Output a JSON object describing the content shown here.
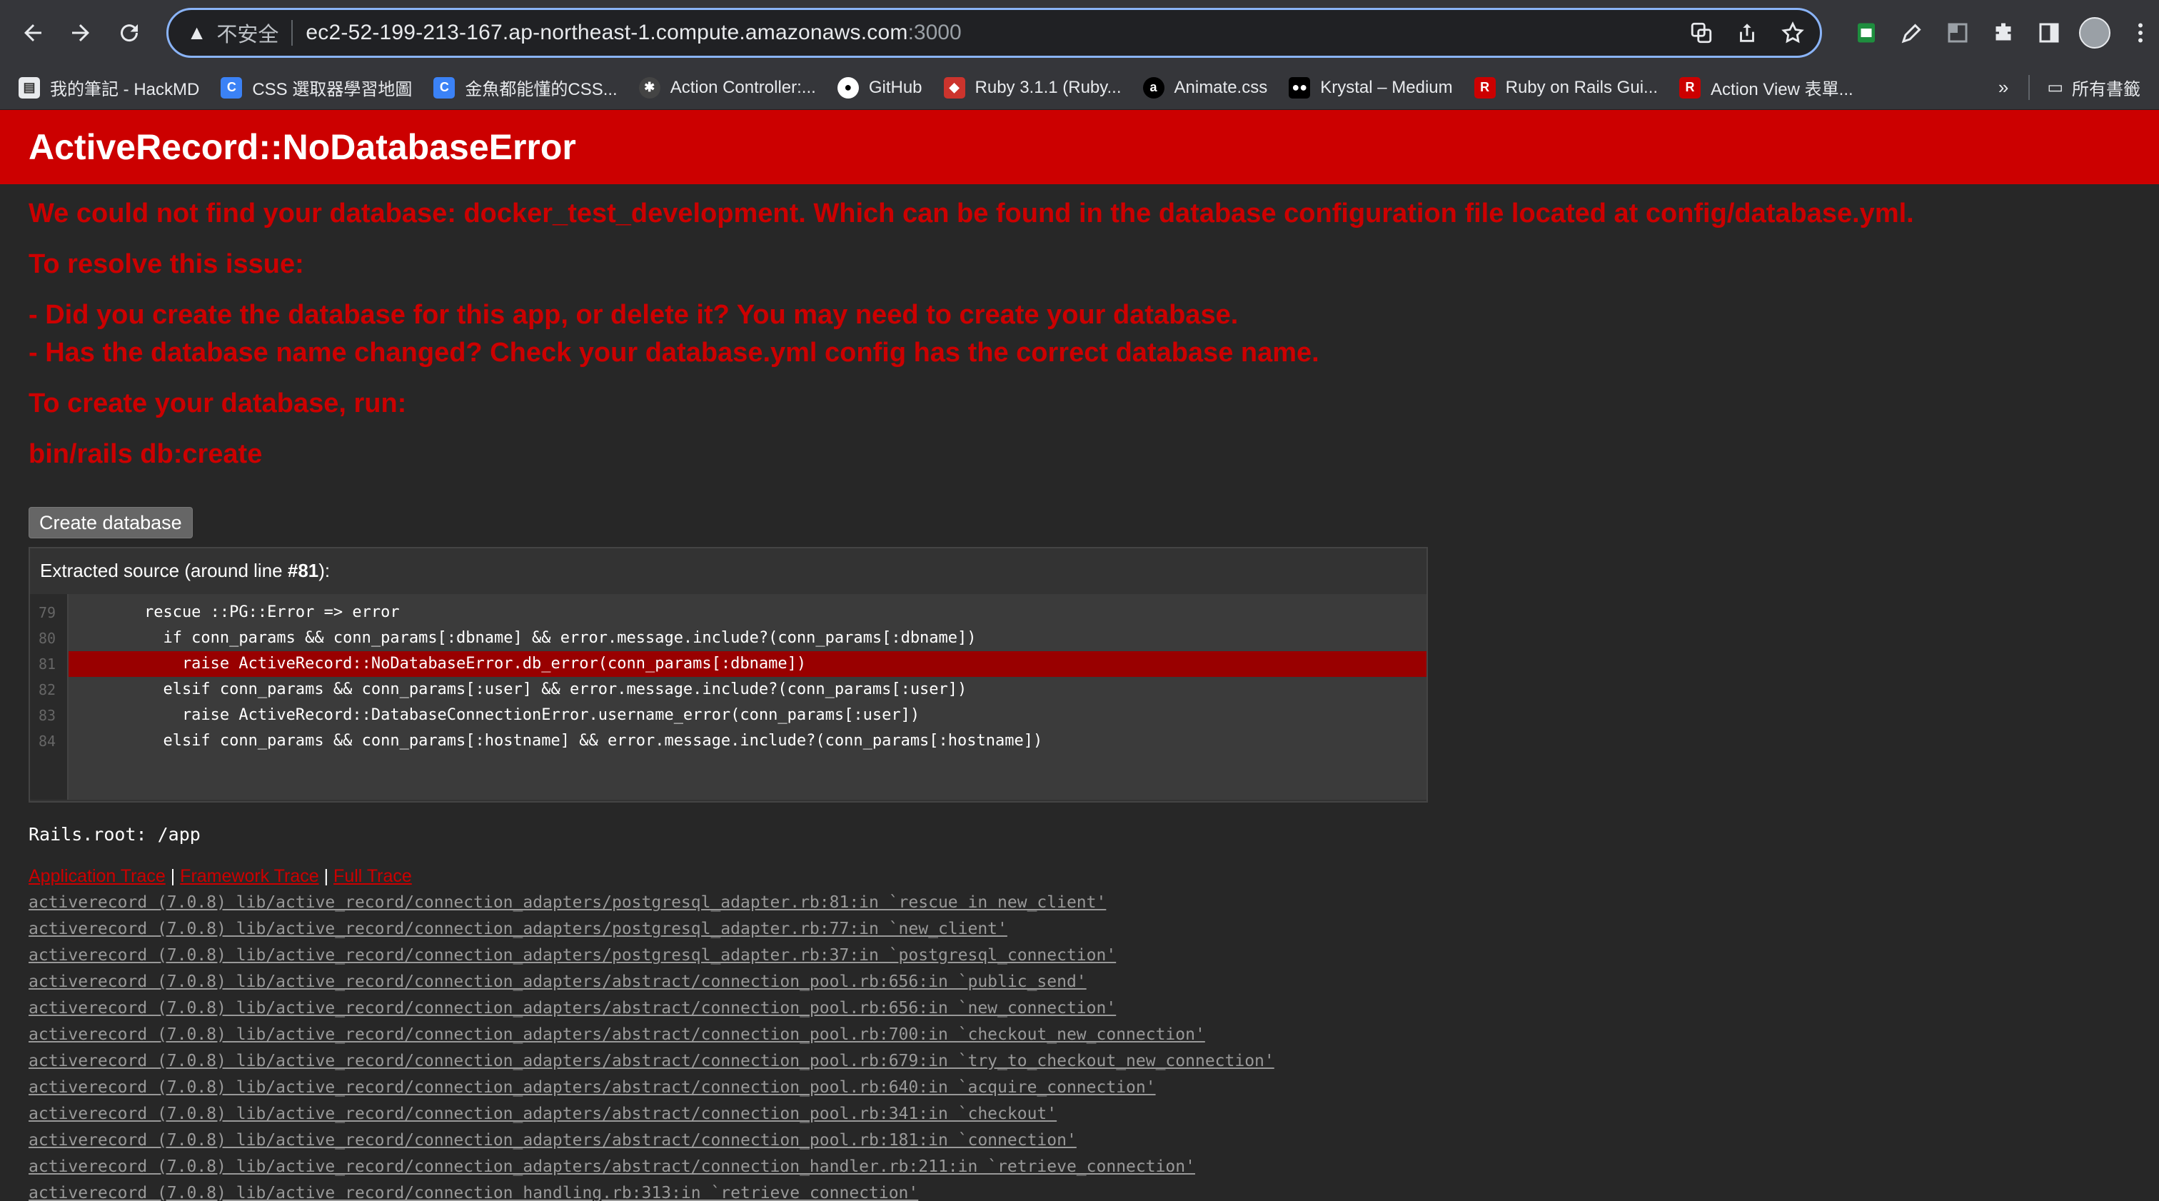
{
  "browser": {
    "security_label": "不安全",
    "url_host": "ec2-52-199-213-167.ap-northeast-1.compute.amazonaws.com",
    "url_port": ":3000",
    "bookmarks": [
      {
        "label": "我的筆記 - HackMD",
        "icon": "document-icon",
        "color": "#e8eaed"
      },
      {
        "label": "CSS 選取器學習地圖",
        "icon": "site-icon",
        "color": "#3b82f6"
      },
      {
        "label": "金魚都能懂的CSS...",
        "icon": "site-icon",
        "color": "#3b82f6"
      },
      {
        "label": "Action Controller:...",
        "icon": "site-icon",
        "color": "#444444"
      },
      {
        "label": "GitHub",
        "icon": "github-icon",
        "color": "#ffffff"
      },
      {
        "label": "Ruby 3.1.1 (Ruby...",
        "icon": "ruby-icon",
        "color": "#cc342d"
      },
      {
        "label": "Animate.css",
        "icon": "animate-icon",
        "color": "#000000"
      },
      {
        "label": "Krystal – Medium",
        "icon": "medium-icon",
        "color": "#000000"
      },
      {
        "label": "Ruby on Rails Gui...",
        "icon": "rails-icon",
        "color": "#cc0000"
      },
      {
        "label": "Action View 表單...",
        "icon": "rails-icon",
        "color": "#cc0000"
      }
    ],
    "bookmarks_more": "»",
    "all_bookmarks": "所有書籤"
  },
  "page": {
    "title": "ActiveRecord::NoDatabaseError",
    "message": "We could not find your database: docker_test_development. Which can be found in the database configuration file located at config/database.yml.",
    "resolve": "To resolve this issue:",
    "suggestions": [
      "- Did you create the database for this app, or delete it? You may need to create your database.",
      "- Has the database name changed? Check your database.yml config has the correct database name."
    ],
    "create_prompt": "To create your database, run:",
    "command": "bin/rails db:create",
    "create_button": "Create database",
    "source_label": "Extracted source (around line ",
    "source_line": "#81",
    "source_suffix": "):",
    "code": [
      {
        "num": "79",
        "text": "        rescue ::PG::Error => error"
      },
      {
        "num": "80",
        "text": "          if conn_params && conn_params[:dbname] && error.message.include?(conn_params[:dbname])"
      },
      {
        "num": "81",
        "text": "            raise ActiveRecord::NoDatabaseError.db_error(conn_params[:dbname])"
      },
      {
        "num": "82",
        "text": "          elsif conn_params && conn_params[:user] && error.message.include?(conn_params[:user])"
      },
      {
        "num": "83",
        "text": "            raise ActiveRecord::DatabaseConnectionError.username_error(conn_params[:user])"
      },
      {
        "num": "84",
        "text": "          elsif conn_params && conn_params[:hostname] && error.message.include?(conn_params[:hostname])"
      }
    ],
    "highlight_line": "81",
    "rails_root": "Rails.root: /app",
    "trace_tabs": [
      "Application Trace",
      "Framework Trace",
      "Full Trace"
    ],
    "trace_sep": " | ",
    "trace": [
      "activerecord (7.0.8) lib/active_record/connection_adapters/postgresql_adapter.rb:81:in `rescue in new_client'",
      "activerecord (7.0.8) lib/active_record/connection_adapters/postgresql_adapter.rb:77:in `new_client'",
      "activerecord (7.0.8) lib/active_record/connection_adapters/postgresql_adapter.rb:37:in `postgresql_connection'",
      "activerecord (7.0.8) lib/active_record/connection_adapters/abstract/connection_pool.rb:656:in `public_send'",
      "activerecord (7.0.8) lib/active_record/connection_adapters/abstract/connection_pool.rb:656:in `new_connection'",
      "activerecord (7.0.8) lib/active_record/connection_adapters/abstract/connection_pool.rb:700:in `checkout_new_connection'",
      "activerecord (7.0.8) lib/active_record/connection_adapters/abstract/connection_pool.rb:679:in `try_to_checkout_new_connection'",
      "activerecord (7.0.8) lib/active_record/connection_adapters/abstract/connection_pool.rb:640:in `acquire_connection'",
      "activerecord (7.0.8) lib/active_record/connection_adapters/abstract/connection_pool.rb:341:in `checkout'",
      "activerecord (7.0.8) lib/active_record/connection_adapters/abstract/connection_pool.rb:181:in `connection'",
      "activerecord (7.0.8) lib/active_record/connection_adapters/abstract/connection_handler.rb:211:in `retrieve_connection'",
      "activerecord (7.0.8) lib/active_record/connection_handling.rb:313:in `retrieve_connection'"
    ]
  }
}
